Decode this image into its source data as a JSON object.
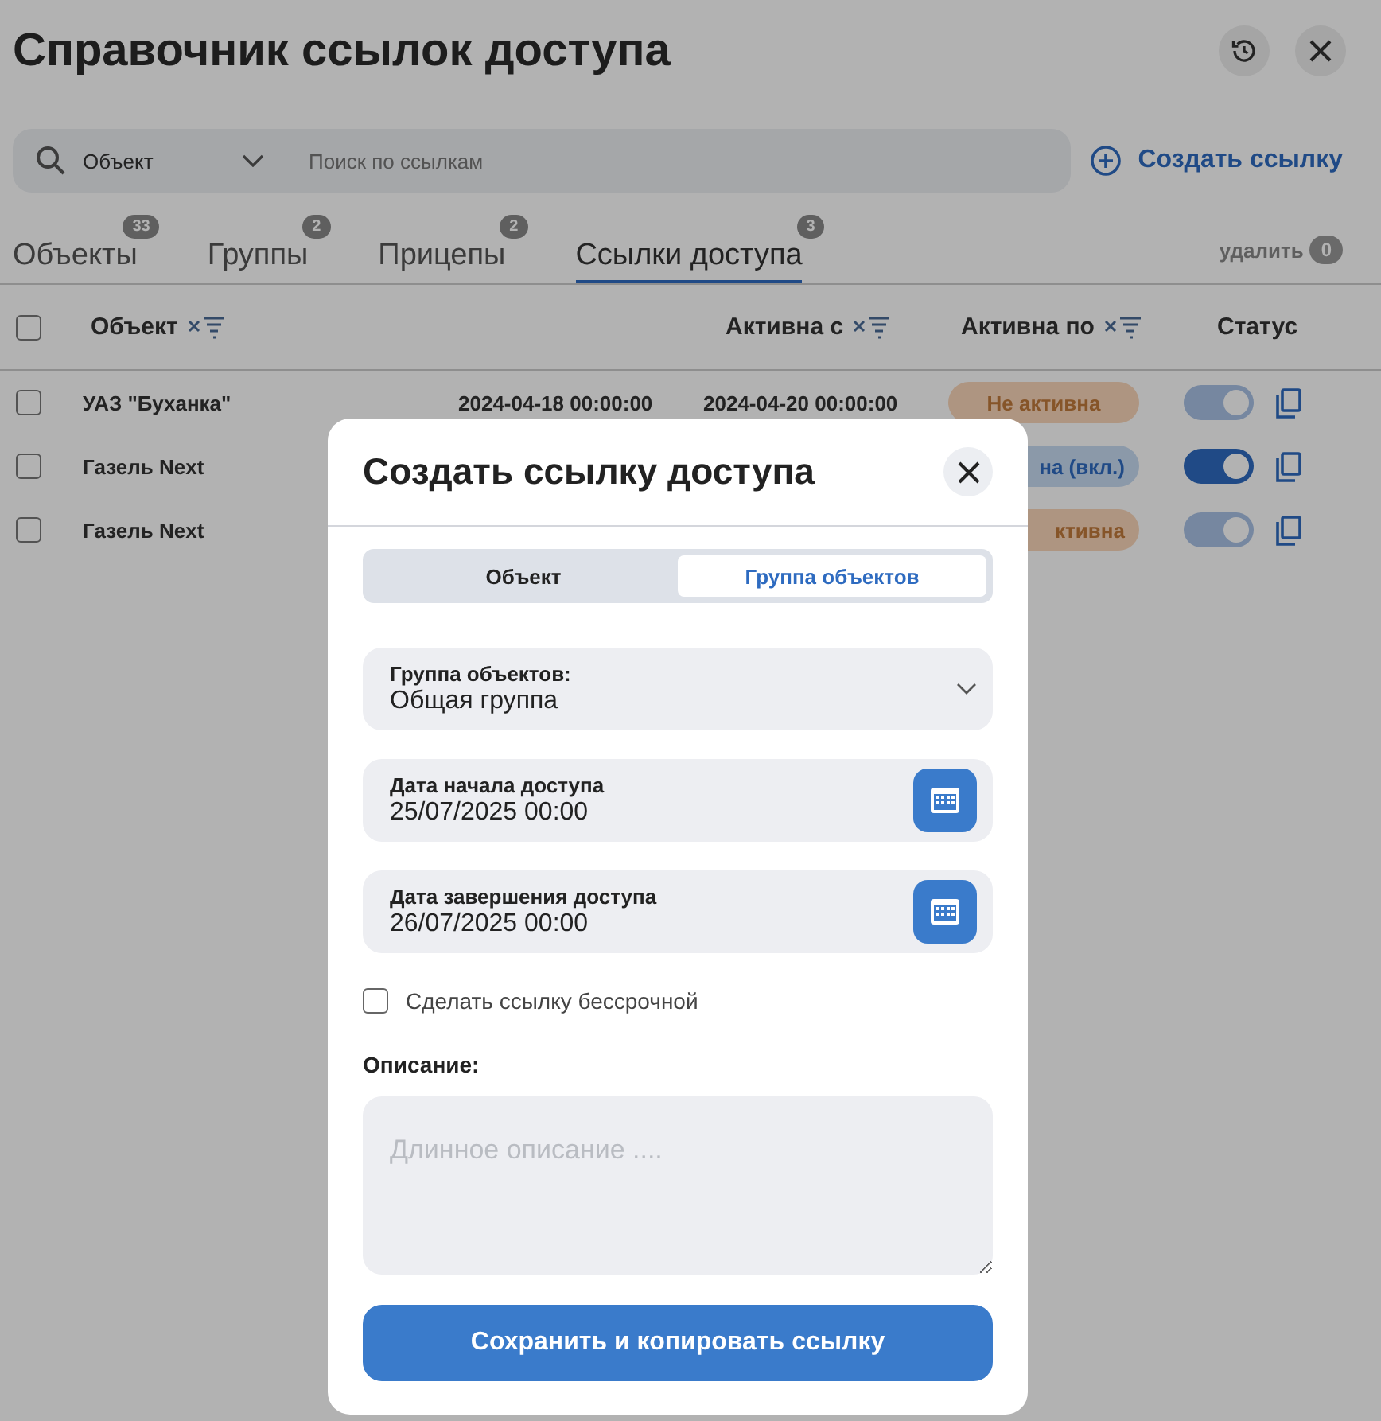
{
  "page": {
    "title": "Справочник ссылок доступа"
  },
  "search": {
    "filter_value": "Объект",
    "placeholder": "Поиск по ссылкам"
  },
  "create_link": "Создать ссылку",
  "tabs": [
    {
      "label": "Объекты",
      "count": "33",
      "selected": false
    },
    {
      "label": "Группы",
      "count": "2",
      "selected": false
    },
    {
      "label": "Прицепы",
      "count": "2",
      "selected": false
    },
    {
      "label": "Ссылки доступа",
      "count": "3",
      "selected": true
    }
  ],
  "delete": {
    "label": "удалить",
    "count": "0"
  },
  "table": {
    "all_checked": false,
    "columns": [
      "Объект",
      "Активна с",
      "Активна по",
      "Статус"
    ],
    "rows": [
      {
        "name": "УАЗ \"Буханка\"",
        "from": "2024-04-18 00:00:00",
        "to": "2024-04-20 00:00:00",
        "status": "Не активна",
        "kind": "inactive",
        "on": true,
        "checked": false
      },
      {
        "name": "Газель Next",
        "status": "на (вкл.)",
        "kind": "active",
        "on": true,
        "checked": false
      },
      {
        "name": "Газель Next",
        "status": "ктивна",
        "kind": "inactive",
        "on": true,
        "checked": false
      }
    ]
  },
  "modal": {
    "title": "Создать ссылку доступа",
    "segments": [
      {
        "label": "Объект",
        "selected": false
      },
      {
        "label": "Группа объектов",
        "selected": true
      }
    ],
    "group_select": {
      "label": "Группа объектов:",
      "value": "Общая группа"
    },
    "start_date": {
      "label": "Дата начала доступа",
      "value": "25/07/2025 00:00"
    },
    "end_date": {
      "label": "Дата завершения доступа",
      "value": "26/07/2025 00:00"
    },
    "perpetual": {
      "label": "Сделать ссылку бессрочной",
      "checked": false
    },
    "description": {
      "label": "Описание:",
      "placeholder": "Длинное описание ...."
    },
    "submit": "Сохранить и копировать ссылку"
  }
}
